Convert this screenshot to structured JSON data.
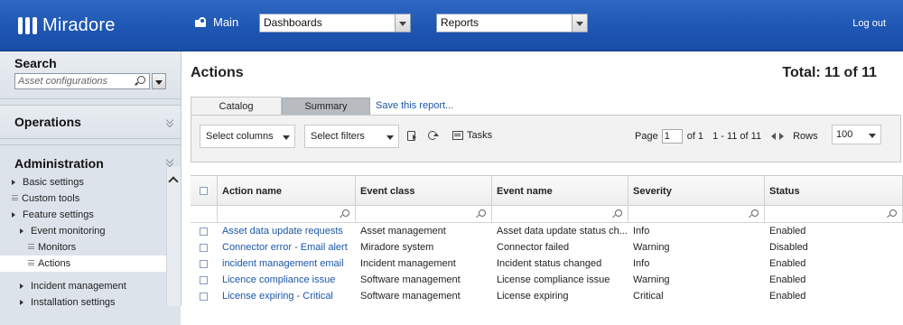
{
  "app": {
    "name": "Miradore",
    "home_label": "Main",
    "logout_label": "Log out"
  },
  "top_selects": {
    "dashboards": "Dashboards",
    "reports": "Reports"
  },
  "sidebar": {
    "search_title": "Search",
    "search_placeholder": "Asset configurations",
    "operations_title": "Operations",
    "administration_title": "Administration",
    "items": [
      {
        "label": "Basic settings",
        "type": "expand",
        "indent": 0
      },
      {
        "label": "Custom tools",
        "type": "leaf",
        "indent": 0
      },
      {
        "label": "Feature settings",
        "type": "expand",
        "indent": 0
      },
      {
        "label": "Event monitoring",
        "type": "expand",
        "indent": 1
      },
      {
        "label": "Monitors",
        "type": "leaf",
        "indent": 2
      },
      {
        "label": "Actions",
        "type": "leaf",
        "indent": 2,
        "active": true
      },
      {
        "label": "Incident management",
        "type": "expand",
        "indent": 1
      },
      {
        "label": "Installation settings",
        "type": "expand",
        "indent": 1
      }
    ]
  },
  "main": {
    "title": "Actions",
    "total": "Total: 11 of 11",
    "tabs": [
      {
        "label": "Catalog",
        "active": true
      },
      {
        "label": "Summary"
      }
    ],
    "save_report": "Save this report...",
    "toolbar": {
      "select_columns": "Select columns",
      "select_filters": "Select filters",
      "tasks": "Tasks",
      "page_label": "Page",
      "page_value": "1",
      "of_label": "of 1",
      "range": "1 - 11 of 11",
      "rows_label": "Rows",
      "rows_value": "100"
    },
    "table": {
      "columns": [
        "Action name",
        "Event class",
        "Event name",
        "Severity",
        "Status"
      ],
      "rows": [
        [
          "Asset data update requests",
          "Asset management",
          "Asset data update status ch...",
          "Info",
          "Enabled"
        ],
        [
          "Connector error - Email alert",
          "Miradore system",
          "Connector failed",
          "Warning",
          "Disabled"
        ],
        [
          "incident management email",
          "Incident management",
          "Incident status changed",
          "Info",
          "Enabled"
        ],
        [
          "Licence compliance issue",
          "Software management",
          "License compliance issue",
          "Warning",
          "Enabled"
        ],
        [
          "License expiring - Critical",
          "Software management",
          "License expiring",
          "Critical",
          "Enabled"
        ]
      ]
    }
  }
}
